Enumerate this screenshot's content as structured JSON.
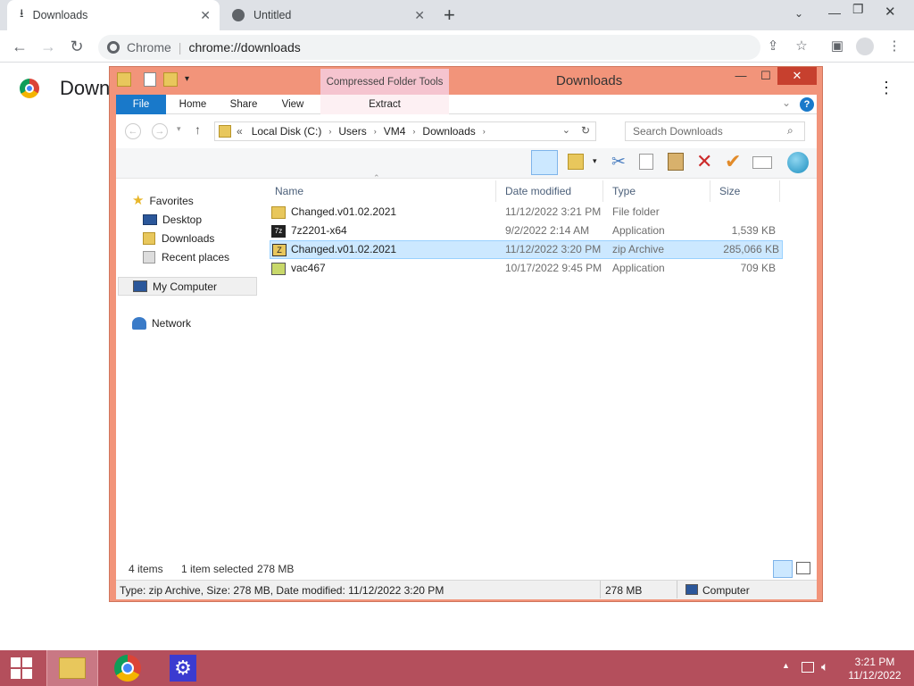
{
  "chrome": {
    "tabs": [
      {
        "label": "Downloads",
        "icon": "download-icon"
      },
      {
        "label": "Untitled",
        "icon": "globe-icon"
      }
    ],
    "new_tab": "+",
    "omnibox": {
      "site": "Chrome",
      "url": "chrome://downloads"
    },
    "page_title": "Down"
  },
  "explorer": {
    "title": "Downloads",
    "contextual_tab": "Compressed Folder Tools",
    "ribbon_tabs": [
      "File",
      "Home",
      "Share",
      "View",
      "Extract"
    ],
    "address": {
      "prefix": "«",
      "crumbs": [
        "Local Disk (C:)",
        "Users",
        "VM4",
        "Downloads"
      ]
    },
    "search_placeholder": "Search Downloads",
    "nav": {
      "favorites": "Favorites",
      "favorite_items": [
        "Desktop",
        "Downloads",
        "Recent places"
      ],
      "my_computer": "My Computer",
      "network": "Network"
    },
    "columns": [
      "Name",
      "Date modified",
      "Type",
      "Size"
    ],
    "files": [
      {
        "name": "Changed.v01.02.2021",
        "date": "11/12/2022 3:21 PM",
        "type": "File folder",
        "size": "",
        "icon": "folder-icon",
        "selected": false
      },
      {
        "name": "7z2201-x64",
        "date": "9/2/2022 2:14 AM",
        "type": "Application",
        "size": "1,539 KB",
        "icon": "sevenzip-icon",
        "selected": false
      },
      {
        "name": "Changed.v01.02.2021",
        "date": "11/12/2022 3:20 PM",
        "type": "zip Archive",
        "size": "285,066 KB",
        "icon": "zip-archive-icon",
        "selected": true
      },
      {
        "name": "vac467",
        "date": "10/17/2022 9:45 PM",
        "type": "Application",
        "size": "709 KB",
        "icon": "installer-icon",
        "selected": false
      }
    ],
    "status": {
      "items": "4 items",
      "selected": "1 item selected",
      "selected_size": "278 MB"
    },
    "details": {
      "text": "Type: zip Archive, Size: 278 MB, Date modified: 11/12/2022 3:20 PM",
      "size": "278 MB",
      "location": "Computer"
    }
  },
  "taskbar": {
    "time": "3:21 PM",
    "date": "11/12/2022"
  },
  "colors": {
    "window_frame": "#f2947a",
    "taskbar": "#b44f5c",
    "file_tab": "#1979ca",
    "selection": "#cce8ff",
    "contextual_tab": "#f5c4cf"
  }
}
